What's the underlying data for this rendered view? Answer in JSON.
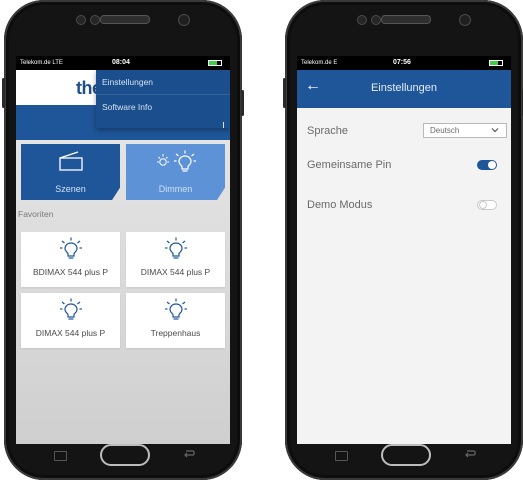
{
  "colors": {
    "brand_blue": "#1f5699",
    "light_blue": "#5d93d6",
    "menu_blue": "#1b4e8c",
    "bezel": "#141414",
    "battery_green": "#3ecf4a"
  },
  "left_phone": {
    "status": {
      "carrier": "Telekom.de  LTE",
      "time": "08:04"
    },
    "logo_text": "the",
    "menu": [
      {
        "label": "Einstellungen"
      },
      {
        "label": "Software Info"
      }
    ],
    "tiles": [
      {
        "label": "Szenen",
        "icon": "scene-icon"
      },
      {
        "label": "Dimmen",
        "icon": "bulb-dim-icon"
      }
    ],
    "favorites_heading": "Favoriten",
    "favorites": [
      {
        "label": "BDIMAX 544 plus P",
        "icon": "bulb-icon"
      },
      {
        "label": "DIMAX 544 plus P",
        "icon": "bulb-icon"
      },
      {
        "label": "DIMAX 544 plus P",
        "icon": "bulb-icon"
      },
      {
        "label": "Treppenhaus",
        "icon": "bulb-icon"
      }
    ]
  },
  "right_phone": {
    "status": {
      "carrier": "Telekom.de  E",
      "time": "07:56"
    },
    "title": "Einstellungen",
    "back_icon": "arrow-left-icon",
    "settings": {
      "language_label": "Sprache",
      "language_value": "Deutsch",
      "shared_pin_label": "Gemeinsame Pin",
      "shared_pin_on": true,
      "demo_mode_label": "Demo Modus",
      "demo_mode_on": false
    }
  }
}
